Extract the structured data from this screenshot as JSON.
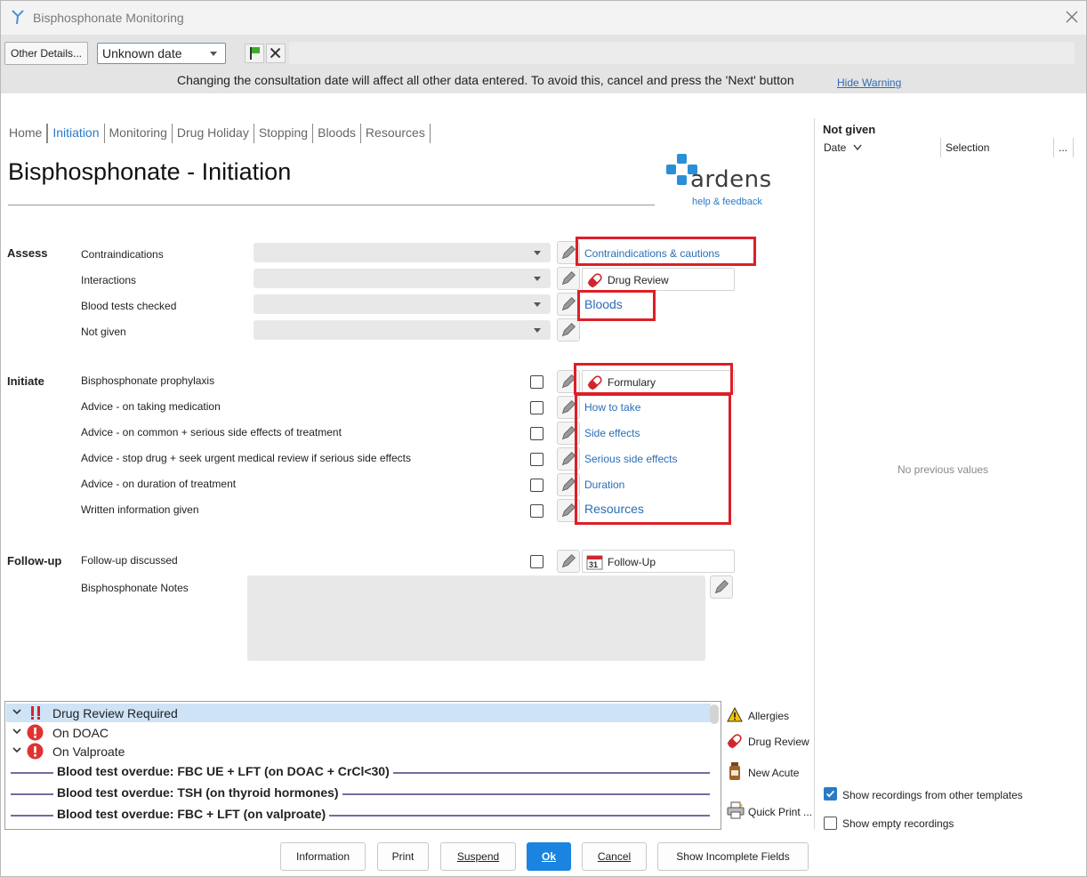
{
  "window": {
    "title": "Bisphosphonate Monitoring"
  },
  "toolbar": {
    "other_details_label": "Other Details...",
    "date_value": "Unknown date",
    "warning_text": "Changing the consultation date will affect all other data entered. To avoid this, cancel and press the 'Next' button",
    "hide_warning_label": "Hide Warning"
  },
  "tabs": [
    {
      "label": "Home"
    },
    {
      "label": "Initiation",
      "active": true
    },
    {
      "label": "Monitoring"
    },
    {
      "label": "Drug Holiday"
    },
    {
      "label": "Stopping"
    },
    {
      "label": "Bloods"
    },
    {
      "label": "Resources"
    }
  ],
  "page": {
    "title": "Bisphosphonate - Initiation",
    "logo_text": "ardens",
    "logo_sub": "help & feedback"
  },
  "assess": {
    "heading": "Assess",
    "fields": [
      {
        "label": "Contraindications"
      },
      {
        "label": "Interactions"
      },
      {
        "label": "Blood tests checked"
      },
      {
        "label": "Not given"
      }
    ],
    "contraindications_link": "Contraindications & cautions",
    "drug_review_button": "Drug Review",
    "bloods_link": "Bloods"
  },
  "initiate": {
    "heading": "Initiate",
    "fields": [
      {
        "label": "Bisphosphonate prophylaxis"
      },
      {
        "label": "Advice - on taking medication"
      },
      {
        "label": "Advice - on common + serious side effects of treatment"
      },
      {
        "label": "Advice - stop drug + seek urgent medical review if serious side effects"
      },
      {
        "label": "Advice - on duration of treatment"
      },
      {
        "label": "Written information given"
      }
    ],
    "formulary_button": "Formulary",
    "links": [
      "How to take",
      "Side effects",
      "Serious side effects",
      "Duration",
      "Resources"
    ]
  },
  "followup": {
    "heading": "Follow-up",
    "discussed_label": "Follow-up discussed",
    "notes_label": "Bisphosphonate Notes",
    "followup_button": "Follow-Up"
  },
  "right_panel": {
    "heading": "Not given",
    "col_date": "Date",
    "col_selection": "Selection",
    "col_more": "...",
    "empty_text": "No previous values",
    "show_other_templates": "Show recordings from other templates",
    "show_empty": "Show empty recordings"
  },
  "alerts": {
    "items": [
      {
        "label": "Drug Review Required"
      },
      {
        "label": "On DOAC"
      },
      {
        "label": "On Valproate"
      }
    ],
    "blood_tests": [
      "Blood test overdue: FBC UE + LFT (on DOAC + CrCl<30)",
      "Blood test overdue: TSH (on thyroid hormones)",
      "Blood test overdue: FBC + LFT (on valproate)"
    ]
  },
  "side_buttons": {
    "allergies": "Allergies",
    "drug_review": "Drug Review",
    "new_acute": "New Acute",
    "quick_print": "Quick Print ..."
  },
  "footer": {
    "information": "Information",
    "print": "Print",
    "suspend": "Suspend",
    "ok": "Ok",
    "cancel": "Cancel",
    "show_incomplete": "Show Incomplete Fields"
  }
}
